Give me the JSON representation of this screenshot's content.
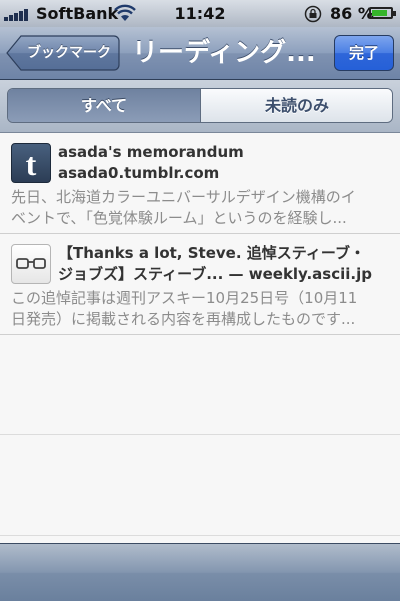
{
  "status_bar": {
    "carrier": "SoftBank",
    "time": "11:42",
    "battery_percent": "86 %",
    "battery_level": 0.86,
    "icons": [
      "signal-icon",
      "wifi-icon",
      "rotation-lock-icon",
      "battery-icon"
    ]
  },
  "nav": {
    "back_label": "ブックマーク",
    "title": "リーディング...",
    "done_label": "完了"
  },
  "segments": {
    "all": "すべて",
    "unread": "未読のみ",
    "selected": "すべて"
  },
  "items": [
    {
      "icon": "tumblr-icon",
      "icon_letter": "t",
      "title_line1": "asada's memorandum",
      "title_line2": "asada0.tumblr.com",
      "excerpt_line1": "先日、北海道カラーユニバーサルデザイン機構のイ",
      "excerpt_line2": "ベントで、「色覚体験ルーム」というのを経験し..."
    },
    {
      "icon": "glasses-icon",
      "title_line1": "【Thanks a lot, Steve. 追悼スティーブ・",
      "title_line2": "ジョブズ】スティーブ... — weekly.ascii.jp",
      "excerpt_line1": "この追悼記事は週刊アスキー10月25日号（10月11",
      "excerpt_line2": "日発売）に掲載される内容を再構成したものです..."
    }
  ],
  "colors": {
    "nav_bar": "#8da0bd",
    "done_button": "#2f66d9",
    "battery_fill": "#35b52b",
    "excerpt_text": "#8c8c8c"
  }
}
